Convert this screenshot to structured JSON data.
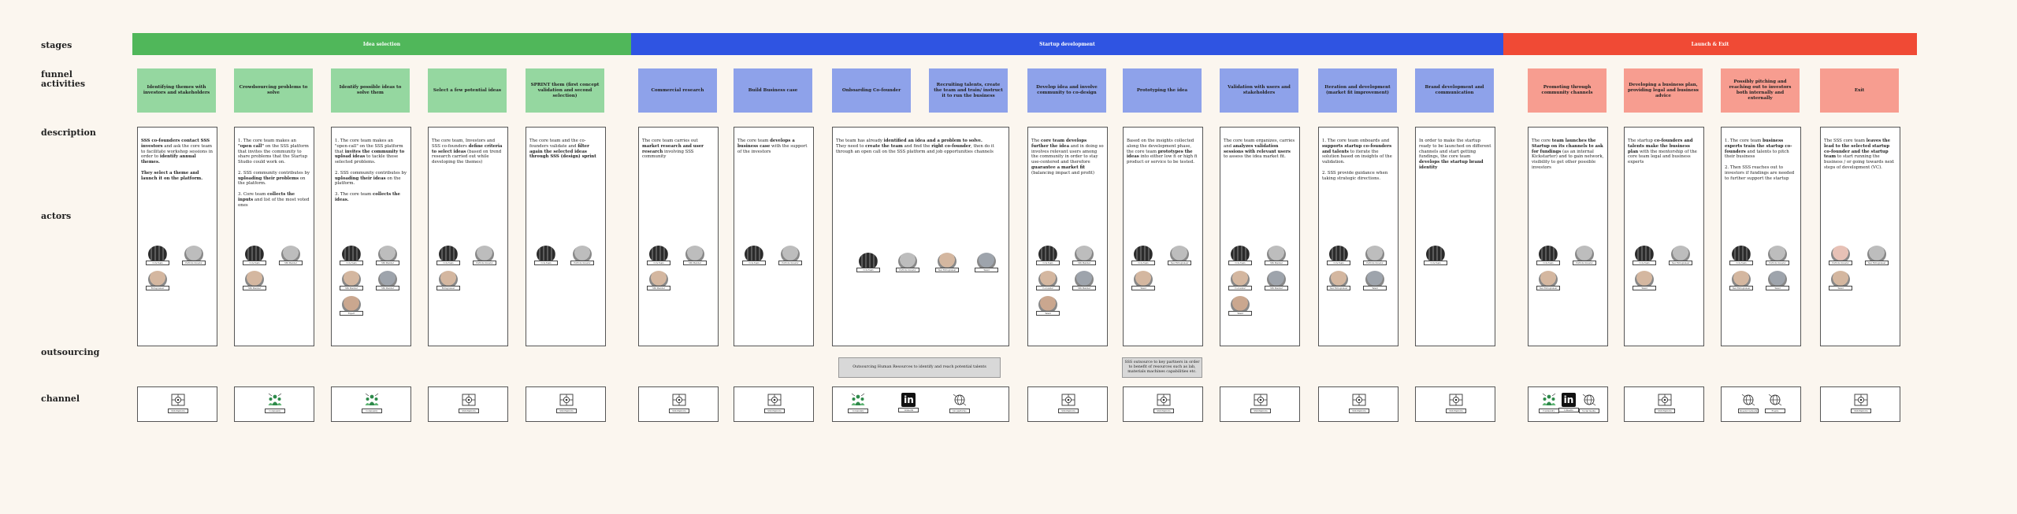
{
  "rows": {
    "stages": "stages",
    "funnel": [
      "funnel",
      "activities"
    ],
    "description": "description",
    "actors": "actors",
    "outsourcing": "outsourcing",
    "channel": "channel"
  },
  "phases": [
    {
      "label": "Idea selection",
      "color": "#50b75a"
    },
    {
      "label": "Startup development",
      "color": "#2f54e2"
    },
    {
      "label": "Launch & Exit",
      "color": "#f04a35"
    }
  ],
  "stages": [
    {
      "label": "Identifying themes with investors and stakeholders",
      "color": "green",
      "desc": [
        {
          "t": "SSS co-founders contact SSS investors",
          "b": 1
        },
        {
          "t": " and ask the core team to facilitate workshop sessions in order to "
        },
        {
          "t": "identify annual themes.",
          "b": 1
        },
        {
          "br": 2
        },
        {
          "t": "They select a theme and launch it on the platform.",
          "b": 1
        }
      ],
      "actors": [
        "Core Team",
        "Portfolio Investor",
        "Entrepreneur"
      ],
      "channels": [
        {
          "icon": "platform",
          "label": "SSS Platform"
        }
      ]
    },
    {
      "label": "Crowdsourcing problems to solve",
      "color": "green",
      "desc": [
        {
          "t": "1. The core team makes an "
        },
        {
          "t": "\"open call\"",
          "b": 1
        },
        {
          "t": " on the SSS platform that invites the community to share problems that the Startup Studio could work on."
        },
        {
          "br": 2
        },
        {
          "t": "2. SSS community contributes by "
        },
        {
          "t": "uploading their problems",
          "b": 1
        },
        {
          "t": " on the platform."
        },
        {
          "br": 2
        },
        {
          "t": "3. Core team "
        },
        {
          "t": "collects the inputs",
          "b": 1
        },
        {
          "t": " and list of the most voted ones"
        }
      ],
      "actors": [
        "Core Team",
        "SSS Member",
        "SSS Member"
      ],
      "channels": [
        {
          "icon": "community",
          "label": "Community"
        }
      ]
    },
    {
      "label": "Identify possible ideas to solve them",
      "color": "green",
      "desc": [
        {
          "t": "1. The core team makes an \"open-call\" on the SSS platform that "
        },
        {
          "t": "invites the community to upload ideas",
          "b": 1
        },
        {
          "t": " to tackle those selected problems."
        },
        {
          "br": 2
        },
        {
          "t": "2. SSS community contributes by "
        },
        {
          "t": "uploading their ideas",
          "b": 1
        },
        {
          "t": " on the platform."
        },
        {
          "br": 2
        },
        {
          "t": "3. The core team "
        },
        {
          "t": "collects the ideas.",
          "b": 1
        }
      ],
      "actors": [
        "Core Team",
        "SSS Member",
        "SSS Member",
        "SSS Member",
        "Expert"
      ],
      "channels": [
        {
          "icon": "community",
          "label": "Community"
        }
      ]
    },
    {
      "label": "Select a few potential ideas",
      "color": "green",
      "desc": [
        {
          "t": "The core team, Investors and SSS co-founders "
        },
        {
          "t": "define criteria to select ideas",
          "b": 1
        },
        {
          "t": " (based on trend research carried out while developing the themes)"
        }
      ],
      "actors": [
        "Core Team",
        "Portfolio Investor",
        "Entrepreneur"
      ],
      "channels": [
        {
          "icon": "platform",
          "label": "SSS Platform"
        }
      ]
    },
    {
      "label": "SPRINT them (first concept validation and second selection)",
      "color": "green",
      "desc": [
        {
          "t": "The core team and the co-founders validate and "
        },
        {
          "t": "filter again the selected ideas through SSS (design) sprint",
          "b": 1
        }
      ],
      "actors": [
        "Core Team",
        "Portfolio Investor"
      ],
      "channels": [
        {
          "icon": "platform",
          "label": "SSS Platform"
        }
      ]
    },
    {
      "label": "Commercial research",
      "color": "blue",
      "desc": [
        {
          "t": "The core team carries out "
        },
        {
          "t": "market research and user research",
          "b": 1
        },
        {
          "t": " involving SSS community"
        }
      ],
      "actors": [
        "Core Team",
        "SSS Member",
        "SSS Member"
      ],
      "channels": [
        {
          "icon": "platform",
          "label": "SSS Platform"
        }
      ]
    },
    {
      "label": "Build Business case",
      "color": "blue",
      "desc": [
        {
          "t": "The core team "
        },
        {
          "t": "develops a business case",
          "b": 1
        },
        {
          "t": " with the support of the investors"
        }
      ],
      "actors": [
        "Core Team",
        "Portfolio Investor"
      ],
      "channels": [
        {
          "icon": "platform",
          "label": "SSS Platform"
        }
      ]
    },
    {
      "label": "Onboarding Co-founder",
      "color": "blue",
      "desc": [
        {
          "t": "The team has already "
        },
        {
          "t": "identified an idea and a problem to solve.",
          "b": 1
        },
        {
          "br": 1
        },
        {
          "t": "They need to "
        },
        {
          "t": "create the team",
          "b": 1
        },
        {
          "t": " and find the "
        },
        {
          "t": "right co-founder",
          "b": 1
        },
        {
          "t": ", then do it through an open call on the SSS platform and job opportunities channels"
        }
      ],
      "actors": [
        "Core Team",
        "Portfolio Investor",
        "New Entrepreneur",
        "Talent"
      ],
      "channels": [
        {
          "icon": "community",
          "label": "Community"
        },
        {
          "icon": "linkedin",
          "label": "LinkedIn"
        },
        {
          "icon": "web",
          "label": "Job platforms"
        }
      ]
    },
    {
      "label": "Recruiting talents, create the team and train/ instruct it to run the business",
      "color": "blue",
      "desc": [],
      "actors": [],
      "channels": []
    },
    {
      "label": "Develop idea and involve community to co-design",
      "color": "blue",
      "desc": [
        {
          "t": "The "
        },
        {
          "t": "core team develops further the idea",
          "b": 1
        },
        {
          "t": " and in doing so involves relevant users among the community in order to stay use-centered and therefore "
        },
        {
          "t": "guarantee a market fit",
          "b": 1
        },
        {
          "t": " (balancing impact and profit)"
        }
      ],
      "actors": [
        "Core Team",
        "SSS Member",
        "Co-founder",
        "SSS Member",
        "Talent"
      ],
      "channels": [
        {
          "icon": "platform",
          "label": "SSS Platform"
        }
      ]
    },
    {
      "label": "Prototyping the idea",
      "color": "blue",
      "desc": [
        {
          "t": "Based on the insights collected along the development phase, the core team "
        },
        {
          "t": "prototypes the ideas",
          "b": 1
        },
        {
          "t": " into either low fi or high fi product or service to be tested."
        }
      ],
      "actors": [
        "Core Team",
        "New Entrepreneur",
        "Talent"
      ],
      "channels": [
        {
          "icon": "platform",
          "label": "SSS Platform"
        }
      ]
    },
    {
      "label": "Validation with users and stakeholders",
      "color": "blue",
      "desc": [
        {
          "t": "The core team organizes, carries and "
        },
        {
          "t": "analyzes validation sessions with relevant users",
          "b": 1
        },
        {
          "t": " to assess the idea market fit."
        }
      ],
      "actors": [
        "Core Team",
        "SSS Member",
        "Co-founder",
        "SSS Member",
        "Talent"
      ],
      "channels": [
        {
          "icon": "platform",
          "label": "SSS Platform"
        }
      ]
    },
    {
      "label": "Iteration and development (market fit improvement)",
      "color": "blue",
      "desc": [
        {
          "t": "1. The core team onboards and "
        },
        {
          "t": "supports startup co-founders and talents",
          "b": 1
        },
        {
          "t": " to iterate the solution based on insights of the validation."
        },
        {
          "br": 2
        },
        {
          "t": "2. SSS provide guidance when taking strategic directions."
        }
      ],
      "actors": [
        "Core Team",
        "Portfolio Investor",
        "New Entrepreneur",
        "Talent"
      ],
      "channels": [
        {
          "icon": "platform",
          "label": "SSS Platform"
        }
      ]
    },
    {
      "label": "Brand development and communication",
      "color": "blue",
      "desc": [
        {
          "t": "In order to make the startup ready to be launched on different channels and start getting fundings, the core team "
        },
        {
          "t": "develops the startup brand identity",
          "b": 1
        }
      ],
      "actors": [
        "Core Team"
      ],
      "channels": [
        {
          "icon": "platform",
          "label": "SSS Platform"
        }
      ]
    },
    {
      "label": "Promoting through community channels",
      "color": "red",
      "desc": [
        {
          "t": "The core "
        },
        {
          "t": "team launches the Startup on its channels to ask for fundings",
          "b": 1
        },
        {
          "t": " (as an internal Kickstarter) and to gain network, visibility to get other possible investors"
        }
      ],
      "actors": [
        "Core Team",
        "Portfolio Investor",
        "New Entrepreneur"
      ],
      "channels": [
        {
          "icon": "community",
          "label": "Community"
        },
        {
          "icon": "linkedin",
          "label": "LinkedIn"
        },
        {
          "icon": "web",
          "label": "Social media"
        }
      ]
    },
    {
      "label": "Developing a business plan, providing legal and business advice",
      "color": "red",
      "desc": [
        {
          "t": "The startup "
        },
        {
          "t": "co-founders and talents make the business plan",
          "b": 1
        },
        {
          "t": " with the mentorship of the core team legal and business experts"
        }
      ],
      "actors": [
        "Core Team",
        "New Entrepreneur",
        "Talent"
      ],
      "channels": [
        {
          "icon": "platform",
          "label": "SSS Platform"
        }
      ]
    },
    {
      "label": "Possibly pitching and reaching out to investors both internally and externally",
      "color": "red",
      "desc": [
        {
          "t": "1. The core team "
        },
        {
          "t": "business experts train the startup co-founders",
          "b": 1
        },
        {
          "t": " and talents to pitch their business"
        },
        {
          "br": 2
        },
        {
          "t": "2. Then SSS reaches out to investors if fundings are needed to further support the startup"
        }
      ],
      "actors": [
        "Core Team",
        "Portfolio Investor",
        "New Entrepreneur",
        "Talent"
      ],
      "channels": [
        {
          "icon": "web",
          "label": "Investor network"
        },
        {
          "icon": "web",
          "label": "Events"
        }
      ]
    },
    {
      "label": "Exit",
      "color": "red",
      "desc": [
        {
          "t": "The SSS core team "
        },
        {
          "t": "leaves the lead to the selected startup co-founder and the startup team",
          "b": 1
        },
        {
          "t": " to start running the business / or going towards next steps of development (VC)."
        }
      ],
      "actors": [
        "Portfolio Investor",
        "New Entrepreneur",
        "Talent"
      ],
      "channels": [
        {
          "icon": "platform",
          "label": "SSS Platform"
        }
      ]
    }
  ],
  "outsourcing": [
    {
      "text": "Outsourcing Human Resources to identify and reach potential talents"
    },
    {
      "text": "SSS outsource to key partners in order to benefit of resources such as lab, materials machines capabilities etc."
    }
  ],
  "colors": {
    "background": "#fbf6ef",
    "green": "#95d7a0",
    "blue": "#8ea2ea",
    "red": "#f79d90"
  }
}
